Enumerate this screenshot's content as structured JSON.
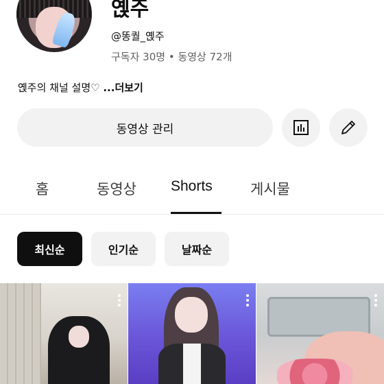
{
  "channel": {
    "name": "옍주",
    "handle": "@똥퀄_옍주",
    "stats": "구독자 30명 • 동영상 72개",
    "description": "옍주의 채널 설명♡ ",
    "more_label": "...더보기"
  },
  "actions": {
    "manage_videos_label": "동영상 관리",
    "analytics_icon": "analytics-icon",
    "edit_icon": "pencil-icon"
  },
  "tabs": [
    {
      "label": "홈"
    },
    {
      "label": "동영상"
    },
    {
      "label": "Shorts",
      "active": true
    },
    {
      "label": "게시물"
    }
  ],
  "chips": [
    {
      "label": "최신순",
      "selected": true
    },
    {
      "label": "인기순"
    },
    {
      "label": "날짜순"
    }
  ],
  "colors": {
    "text": "#0f0f0f",
    "secondary_text": "#606060",
    "chip_selected_bg": "#0f0f0f",
    "button_bg": "#f2f2f2"
  }
}
